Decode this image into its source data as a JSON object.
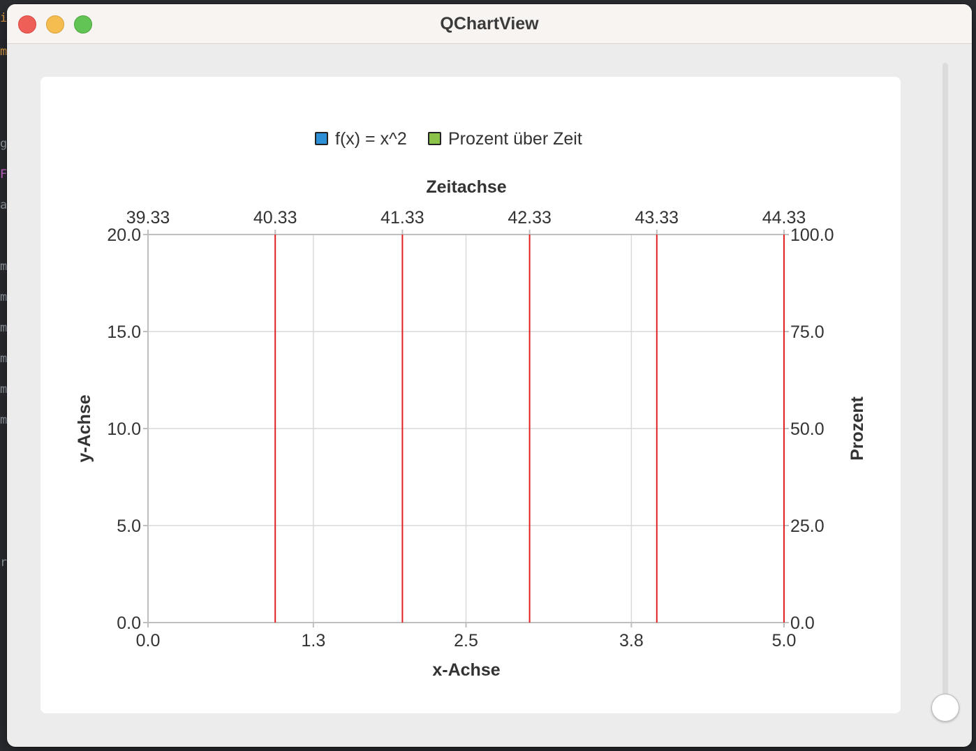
{
  "window": {
    "title": "QChartView"
  },
  "colors": {
    "series_xsquared": "#2d8fd6",
    "series_percent": "#8bc34a",
    "line": "#e02020",
    "grid": "#d9d9d9",
    "axis": "#bfbfbf"
  },
  "chart_data": {
    "type": "line",
    "legend_position": "top",
    "grid": true,
    "series": [
      {
        "name": "f(x) = x^2",
        "icon": "legend-square-blue",
        "x": [],
        "y": []
      },
      {
        "name": "Prozent über Zeit",
        "icon": "legend-square-green",
        "x": [],
        "y": []
      }
    ],
    "axes": {
      "bottom": {
        "title": "x-Achse",
        "range": [
          0.0,
          5.0
        ],
        "ticks": [
          "0.0",
          "1.3",
          "2.5",
          "3.8",
          "5.0"
        ]
      },
      "left": {
        "title": "y-Achse",
        "range": [
          0.0,
          20.0
        ],
        "ticks": [
          "0.0",
          "5.0",
          "10.0",
          "15.0",
          "20.0"
        ]
      },
      "top": {
        "title": "Zeitachse",
        "range": [
          39.33,
          44.33
        ],
        "ticks": [
          "39.33",
          "40.33",
          "41.33",
          "42.33",
          "43.33",
          "44.33"
        ]
      },
      "right": {
        "title": "Prozent",
        "range": [
          0.0,
          100.0
        ],
        "ticks": [
          "0.0",
          "25.0",
          "50.0",
          "75.0",
          "100.0"
        ]
      }
    },
    "top_axis_marker_lines": [
      40.33,
      41.33,
      42.33,
      43.33,
      44.33
    ]
  }
}
